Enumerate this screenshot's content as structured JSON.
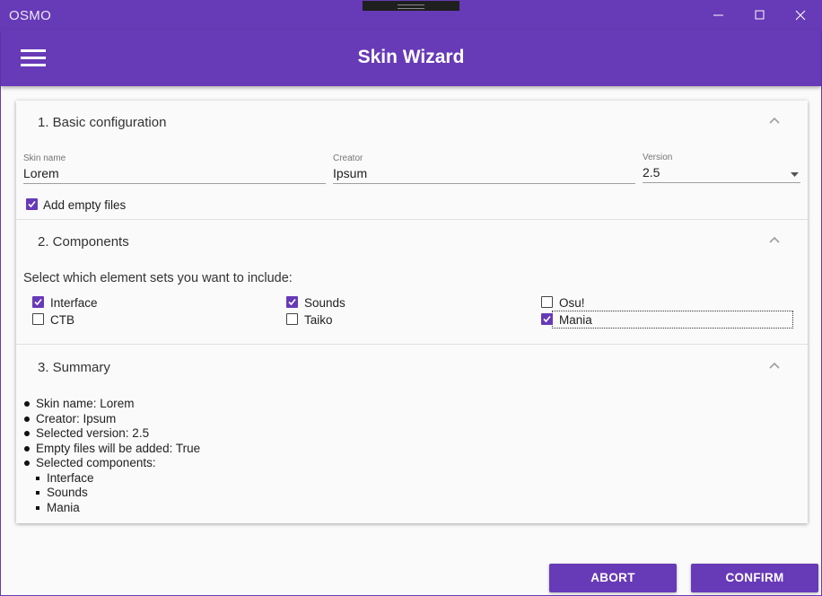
{
  "window": {
    "title": "OSMO",
    "accent": "#673ab7"
  },
  "appbar": {
    "title": "Skin Wizard"
  },
  "basic": {
    "title": "1. Basic configuration",
    "skin_name": {
      "label": "Skin name",
      "value": "Lorem"
    },
    "creator": {
      "label": "Creator",
      "value": "Ipsum"
    },
    "version": {
      "label": "Version",
      "value": "2.5"
    },
    "add_empty_files": {
      "label": "Add empty files",
      "checked": true
    }
  },
  "components": {
    "title": "2. Components",
    "instruction": "Select which element sets you want to include:",
    "items": [
      {
        "label": "Interface",
        "checked": true
      },
      {
        "label": "Sounds",
        "checked": true
      },
      {
        "label": "Osu!",
        "checked": false
      },
      {
        "label": "CTB",
        "checked": false
      },
      {
        "label": "Taiko",
        "checked": false
      },
      {
        "label": "Mania",
        "checked": true
      }
    ]
  },
  "summary": {
    "title": "3. Summary",
    "lines": [
      "Skin name: Lorem",
      "Creator: Ipsum",
      "Selected version: 2.5",
      "Empty files will be added: True",
      "Selected components:"
    ],
    "components": [
      "Interface",
      "Sounds",
      "Mania"
    ]
  },
  "actions": {
    "abort": "ABORT",
    "confirm": "CONFIRM"
  }
}
